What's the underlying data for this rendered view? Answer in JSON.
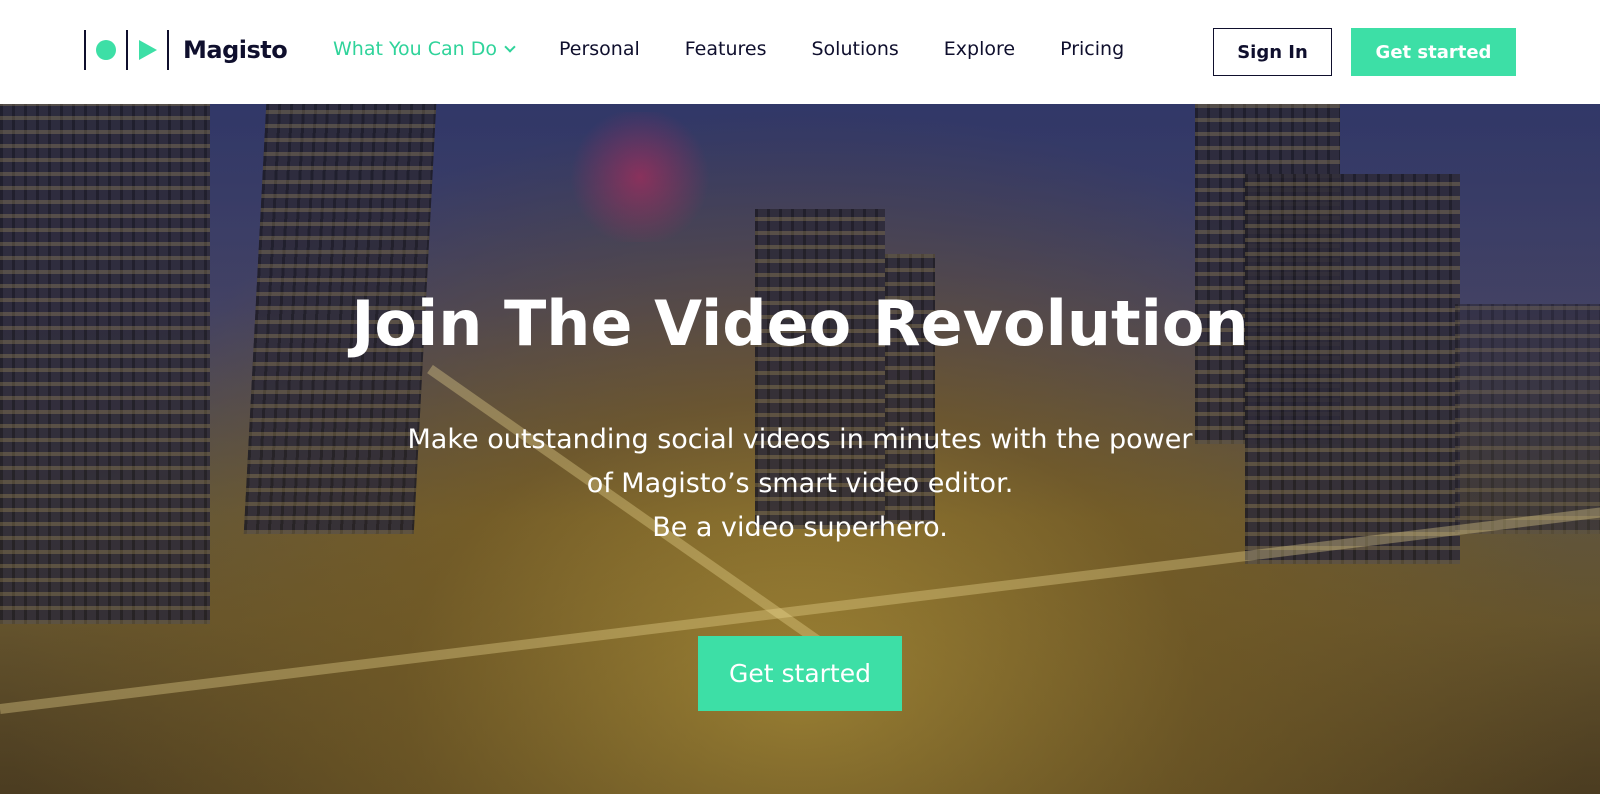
{
  "brand": {
    "name": "Magisto",
    "accent_color": "#3ddfa6",
    "text_color": "#0f0f2d"
  },
  "nav": {
    "items": [
      {
        "label": "What You Can Do",
        "active": true,
        "has_dropdown": true
      },
      {
        "label": "Personal"
      },
      {
        "label": "Features"
      },
      {
        "label": "Solutions"
      },
      {
        "label": "Explore"
      },
      {
        "label": "Pricing"
      }
    ],
    "sign_in_label": "Sign In",
    "get_started_label": "Get started"
  },
  "hero": {
    "title": "Join The Video Revolution",
    "subtitle_lines": [
      "Make outstanding social videos in minutes with the power",
      "of Magisto’s smart video editor.",
      "Be a video superhero."
    ],
    "cta_label": "Get started",
    "background": "city-night-skyline-image"
  }
}
